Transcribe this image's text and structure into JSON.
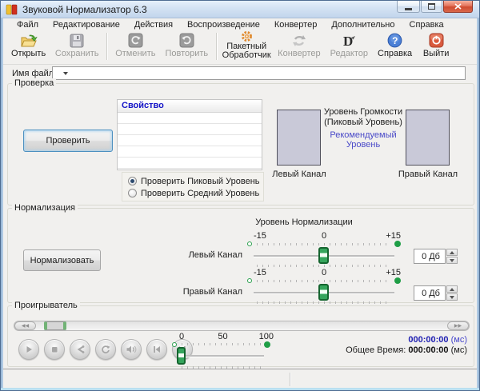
{
  "window": {
    "title": "Звуковой Нормализатор 6.3"
  },
  "menu": {
    "items": [
      "Файл",
      "Редактирование",
      "Действия",
      "Воспроизведение",
      "Конвертер",
      "Дополнительно",
      "Справка"
    ]
  },
  "toolbar": {
    "buttons": [
      {
        "label": "Открыть",
        "icon": "folder-open",
        "enabled": true
      },
      {
        "label": "Сохранить",
        "icon": "floppy-disk",
        "enabled": false
      },
      {
        "label": "Отменить",
        "icon": "undo-arrow",
        "enabled": false
      },
      {
        "label": "Повторить",
        "icon": "redo-arrow",
        "enabled": false
      },
      {
        "label": "Пакетный Обработчик",
        "icon": "gear",
        "enabled": true
      },
      {
        "label": "Конвертер",
        "icon": "convert-arrows",
        "enabled": false
      },
      {
        "label": "Редактор",
        "icon": "editor-d",
        "enabled": false
      },
      {
        "label": "Справка",
        "icon": "help-question",
        "enabled": true
      },
      {
        "label": "Выйти",
        "icon": "power-exit",
        "enabled": true
      }
    ]
  },
  "filename": {
    "label": "Имя файла:",
    "value": ""
  },
  "check": {
    "title": "Проверка",
    "check_button": "Проверить",
    "table_header": "Свойство",
    "volume_title_line1": "Уровень Громкости",
    "volume_title_line2": "(Пиковый Уровень)",
    "recommended_line1": "Рекомендуемый",
    "recommended_line2": "Уровень",
    "left_channel_label": "Левый Канал",
    "right_channel_label": "Правый Канал",
    "radio_peak": "Проверить Пиковый Уровень",
    "radio_average": "Проверить Средний Уровень"
  },
  "normalization": {
    "title": "Нормализация",
    "normalize_button": "Нормализовать",
    "level_title": "Уровень Нормализации",
    "left_channel_label": "Левый Канал",
    "right_channel_label": "Правый Канал",
    "scale_min": "-15",
    "scale_zero": "0",
    "scale_max": "+15",
    "left_value": "0 Дб",
    "right_value": "0 Дб"
  },
  "player": {
    "title": "Проигрыватель",
    "volume_min": "0",
    "volume_mid": "50",
    "volume_max": "100",
    "current_time": "000:00:00",
    "current_unit": "(мс)",
    "total_label": "Общее Время:",
    "total_time": "000:00:00",
    "total_unit": "(мс)"
  },
  "colors": {
    "accent_green": "#1f9e46",
    "link_blue": "#4a4ac8",
    "table_header_blue": "#1414c8",
    "time_blue": "#2121b2",
    "close_red": "#cf4b30",
    "meter_lavender": "#c9c9d8"
  }
}
